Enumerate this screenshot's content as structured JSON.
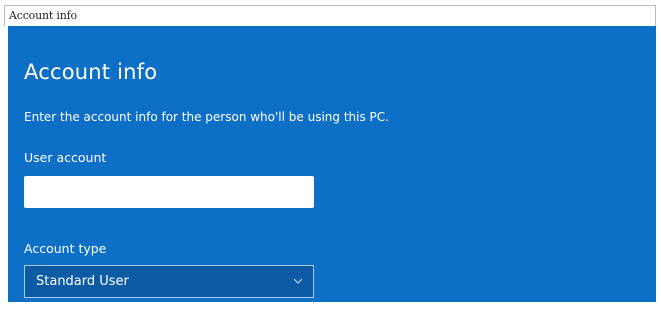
{
  "window": {
    "title": "Account info"
  },
  "main": {
    "heading": "Account info",
    "instruction": "Enter the account info for the person who'll be using this PC.",
    "user_account": {
      "label": "User account",
      "value": "",
      "placeholder": ""
    },
    "account_type": {
      "label": "Account type",
      "selected": "Standard User"
    }
  },
  "icons": {
    "dropdown": "chevron-down-icon"
  },
  "colors": {
    "panel_background": "#0e6fc6",
    "select_background": "#0c5ba4",
    "text": "#ffffff"
  }
}
